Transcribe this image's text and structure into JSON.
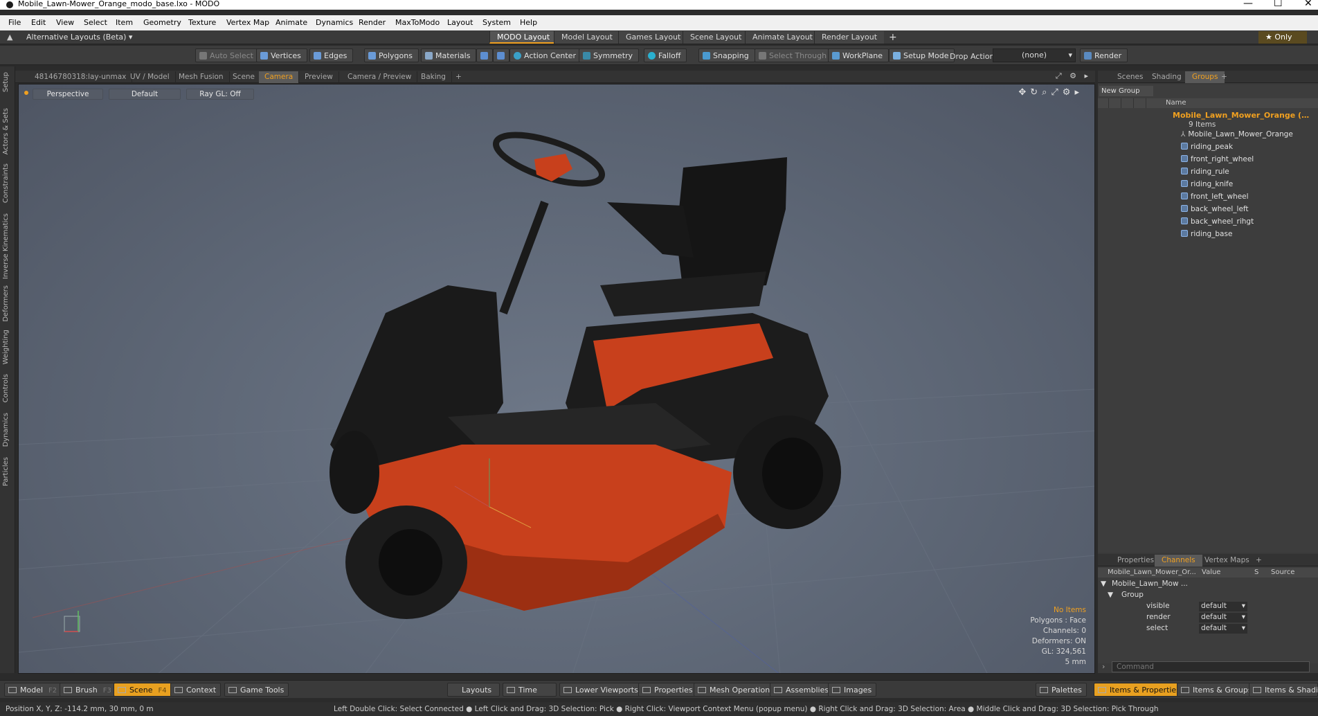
{
  "window": {
    "title": "Mobile_Lawn-Mower_Orange_modo_base.lxo - MODO",
    "controls": {
      "minimize": "—",
      "maximize": "☐",
      "close": "✕"
    }
  },
  "menu": [
    "File",
    "Edit",
    "View",
    "Select",
    "Item",
    "Geometry",
    "Texture",
    "Vertex Map",
    "Animate",
    "Dynamics",
    "Render",
    "MaxToModo",
    "Layout",
    "System",
    "Help"
  ],
  "layouts": {
    "switcher": "Alternative Layouts (Beta) ▾",
    "tabs": [
      "MODO Layout",
      "Model Layout",
      "Games Layout",
      "Scene Layout",
      "Animate Layout",
      "Render Layout"
    ],
    "active": "MODO Layout",
    "add": "+",
    "only": "★  Only"
  },
  "toolbar": {
    "auto_select": "Auto Select",
    "vertices": "Vertices",
    "edges": "Edges",
    "polygons": "Polygons",
    "materials": "Materials",
    "action_center": "Action Center",
    "symmetry": "Symmetry",
    "falloff": "Falloff",
    "snapping": "Snapping",
    "select_through": "Select Through",
    "workplane": "WorkPlane",
    "setup_mode": "Setup Mode",
    "drop_action_label": "Drop Action",
    "drop_action_value": "(none)",
    "render": "Render"
  },
  "left_tabs": [
    "Setup",
    "Actors & Sets",
    "Constraints",
    "Inverse Kinematics",
    "Deformers",
    "Weighting",
    "Controls",
    "Dynamics",
    "Particles"
  ],
  "viewport_tabs": [
    "48146780318:lay-unmax",
    "UV / Model",
    "Mesh Fusion",
    "Scene",
    "Camera",
    "Preview",
    "Camera / Preview",
    "Baking",
    "+"
  ],
  "viewport_tab_active": "Camera",
  "viewport": {
    "view": "Perspective",
    "shading": "Default",
    "raygl": "Ray GL: Off",
    "info": {
      "items": "No Items",
      "polygons": "Polygons : Face",
      "channels": "Channels: 0",
      "deformers": "Deformers: ON",
      "gl": "GL: 324,561",
      "scale": "5 mm"
    }
  },
  "right_tabs_top": [
    "Scenes",
    "Shading",
    "Groups",
    "+"
  ],
  "right_tab_top_active": "Groups",
  "groups": {
    "new_group": "New Group",
    "name_header": "Name",
    "root": "Mobile_Lawn_Mower_Orange (…",
    "count": "9 Items",
    "items": [
      "Mobile_Lawn_Mower_Orange",
      "riding_peak",
      "front_right_wheel",
      "riding_rule",
      "riding_knife",
      "front_left_wheel",
      "back_wheel_left",
      "back_wheel_rihgt",
      "riding_base"
    ]
  },
  "right_tabs_bottom": [
    "Properties",
    "Channels",
    "Vertex Maps",
    "+"
  ],
  "right_tab_bottom_active": "Channels",
  "channels": {
    "col_name": "Mobile_Lawn_Mower_Or...",
    "col_value": "Value",
    "col_s": "S",
    "col_source": "Source",
    "root": "Mobile_Lawn_Mow ...",
    "group": "Group",
    "rows": [
      {
        "name": "visible",
        "value": "default"
      },
      {
        "name": "render",
        "value": "default"
      },
      {
        "name": "select",
        "value": "default"
      }
    ]
  },
  "command_placeholder": "Command",
  "bottom": {
    "model": "Model",
    "model_key": "F2",
    "brush": "Brush",
    "brush_key": "F3",
    "scene": "Scene",
    "scene_key": "F4",
    "context": "Context",
    "game_tools": "Game Tools",
    "layouts": "Layouts",
    "time": "Time",
    "lower_viewports": "Lower Viewports",
    "properties": "Properties",
    "mesh_operations": "Mesh Operations",
    "assemblies": "Assemblies",
    "images": "Images",
    "palettes": "Palettes",
    "items_properties": "Items & Properties",
    "items_groups": "Items & Groups",
    "items_shading": "Items & Shading"
  },
  "status": {
    "position": "Position X, Y, Z:   -114.2 mm, 30 mm, 0 m",
    "hints": "Left Double Click: Select Connected ● Left Click and Drag: 3D Selection: Pick ● Right Click: Viewport Context Menu (popup menu) ● Right Click and Drag: 3D Selection: Area ● Middle Click and Drag: 3D Selection: Pick Through"
  },
  "colors": {
    "accent": "#f0a020",
    "mower_body": "#c8401c",
    "viewport_bg": "#5c6574"
  }
}
